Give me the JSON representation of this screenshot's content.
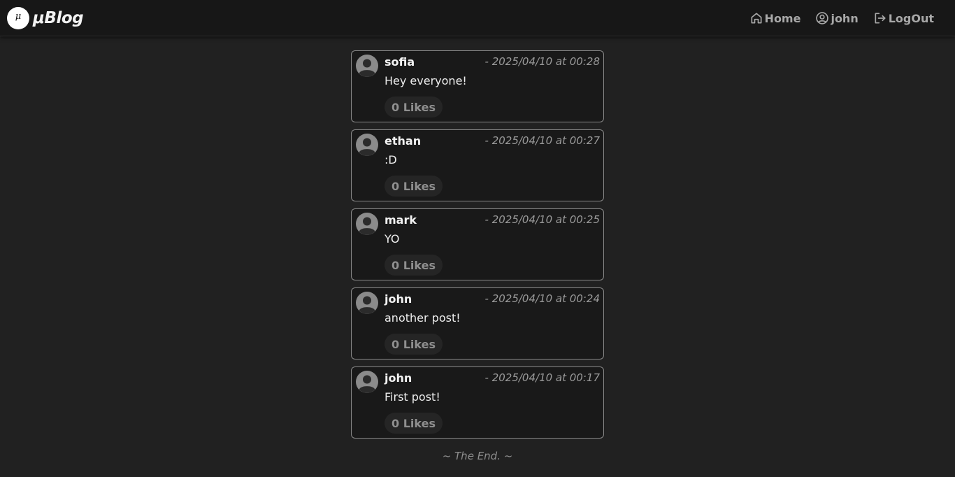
{
  "header": {
    "logo_glyph": "μ",
    "brand": "μBlog",
    "nav": {
      "home": "Home",
      "user": "john",
      "logout": "LogOut"
    }
  },
  "posts": [
    {
      "author": "sofia",
      "date": "- 2025/04/10 at 00:28",
      "body": "Hey everyone!",
      "likes": "0 Likes"
    },
    {
      "author": "ethan",
      "date": "- 2025/04/10 at 00:27",
      "body": ":D",
      "likes": "0 Likes"
    },
    {
      "author": "mark",
      "date": "- 2025/04/10 at 00:25",
      "body": "YO",
      "likes": "0 Likes"
    },
    {
      "author": "john",
      "date": "- 2025/04/10 at 00:24",
      "body": "another post!",
      "likes": "0 Likes"
    },
    {
      "author": "john",
      "date": "- 2025/04/10 at 00:17",
      "body": "First post!",
      "likes": "0 Likes"
    }
  ],
  "footer": {
    "end_text": "~ The End. ~"
  },
  "icons": {
    "home": "home-icon",
    "user": "user-circle-icon",
    "logout": "logout-icon",
    "avatar": "default-avatar-icon"
  },
  "colors": {
    "background": "#212121",
    "topbar": "#171717",
    "card": "#191919",
    "card_border": "#8a8a8a",
    "muted_text": "#9a9a9a"
  }
}
